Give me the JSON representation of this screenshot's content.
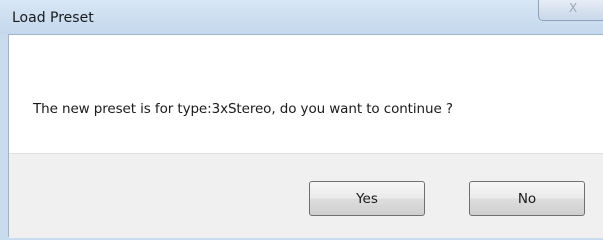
{
  "dialog": {
    "title": "Load Preset",
    "close_icon": "close-icon",
    "close_glyph": "X",
    "message": "The new preset is for type:3xStereo, do you want to continue ?",
    "buttons": {
      "yes_label": "Yes",
      "no_label": "No"
    }
  },
  "colors": {
    "title_bar": "#cddff1",
    "button_area": "#f0f0f0",
    "message_area": "#ffffff"
  }
}
